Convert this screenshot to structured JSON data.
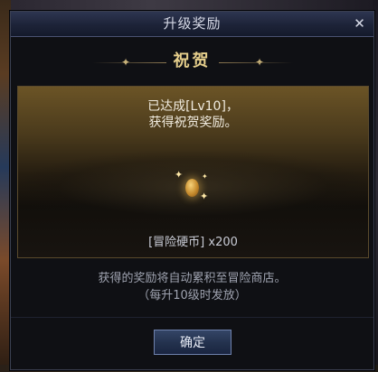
{
  "dialog": {
    "title": "升级奖励",
    "close_glyph": "✕",
    "heading": "祝贺"
  },
  "panel": {
    "achievement_line1": "已达成[Lv10]，",
    "achievement_line2": "获得祝贺奖励。",
    "reward_item_icon": "gold-coin-icon",
    "reward_label": "[冒险硬币] x200"
  },
  "note": {
    "line1": "获得的奖励将自动累积至冒险商店。",
    "line2": "（每升10级时发放）"
  },
  "footer": {
    "confirm_label": "确定"
  },
  "colors": {
    "title_bar": "#1d2338",
    "heading_gold": "#e6cf8c",
    "panel_gold": "#6b5426",
    "button_blue": "#23314d"
  }
}
